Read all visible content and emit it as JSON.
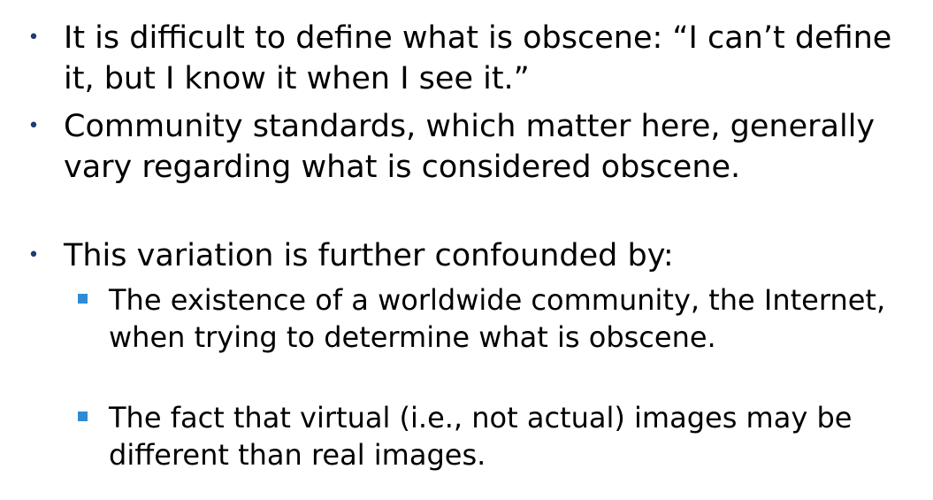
{
  "bullets": [
    {
      "text": "It is difficult to define what is obscene: “I can’t define it, but I know it when I see it.”"
    },
    {
      "text": "Community standards, which matter here, generally vary regarding what is considered obscene."
    },
    {
      "text": "This variation is further confounded by:"
    }
  ],
  "sub_bullets": [
    {
      "text": "The existence of a worldwide community, the Internet, when trying to determine what is obscene."
    },
    {
      "text": "The fact that virtual (i.e., not actual) images may be different than real images."
    }
  ],
  "bullet_glyph": "•",
  "colors": {
    "text": "#000000",
    "bullet_dot": "#1f3b73",
    "sub_bullet_square": "#2e8bd6"
  }
}
